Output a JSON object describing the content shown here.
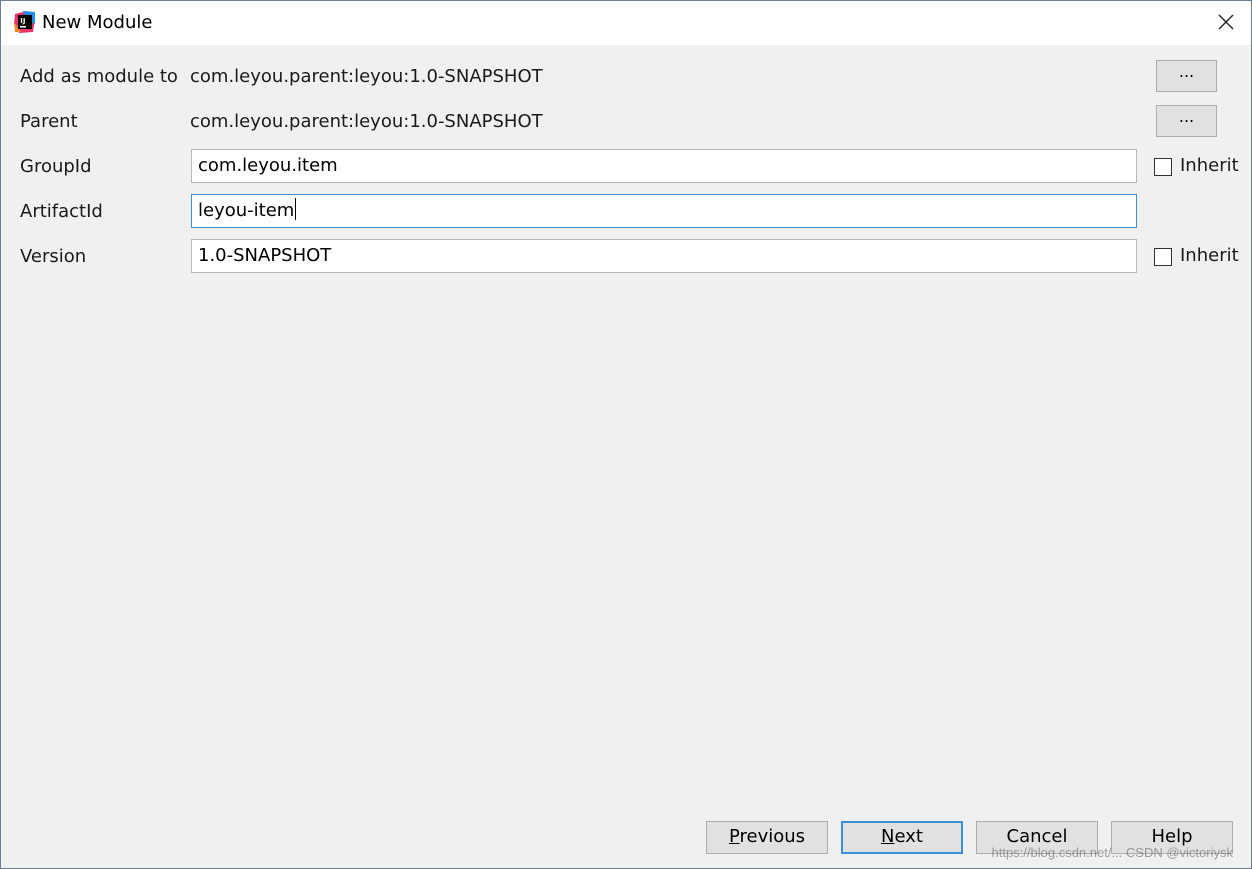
{
  "window": {
    "title": "New Module",
    "icon": "intellij-idea-icon",
    "close_icon": "close-icon"
  },
  "form": {
    "add_as_module_to": {
      "label": "Add as module to",
      "value": "com.leyou.parent:leyou:1.0-SNAPSHOT",
      "button": "..."
    },
    "parent": {
      "label": "Parent",
      "value": "com.leyou.parent:leyou:1.0-SNAPSHOT",
      "button": "..."
    },
    "group_id": {
      "label": "GroupId",
      "value": "com.leyou.item",
      "inherit_label": "Inherit",
      "inherit_checked": false
    },
    "artifact_id": {
      "label": "ArtifactId",
      "value": "leyou-item"
    },
    "version": {
      "label": "Version",
      "value": "1.0-SNAPSHOT",
      "inherit_label": "Inherit",
      "inherit_checked": false
    }
  },
  "buttons": {
    "previous": "Previous",
    "next": "Next",
    "cancel": "Cancel",
    "help": "Help"
  },
  "watermark": "https://blog.csdn.net/... CSDN @victoriysk",
  "colors": {
    "accent": "#3d8fd7",
    "dialog_bg": "#f0f0f0",
    "button_bg": "#e1e1e1"
  }
}
